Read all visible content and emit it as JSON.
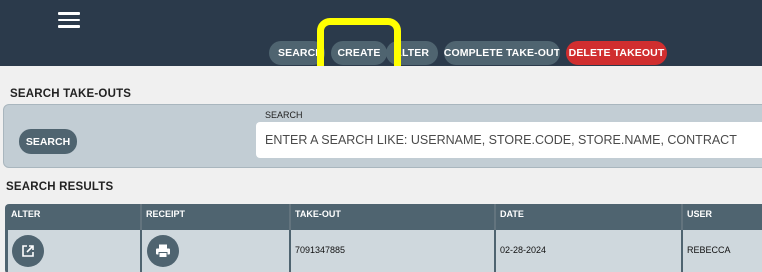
{
  "header": {
    "menu_icon": "hamburger-menu-icon",
    "actions": {
      "search": "SEARCH",
      "create": "CREATE",
      "alter": "ALTER",
      "complete": "COMPLETE TAKE-OUT",
      "delete": "DELETE TAKEOUT"
    },
    "highlight_color": "#ffff00"
  },
  "search_section": {
    "title": "SEARCH TAKE-OUTS",
    "button_label": "SEARCH",
    "field_label": "SEARCH",
    "placeholder": "ENTER A SEARCH LIKE: USERNAME, STORE.CODE, STORE.NAME, CONTRACT"
  },
  "results": {
    "title": "SEARCH RESULTS",
    "columns": [
      "ALTER",
      "RECEIPT",
      "TAKE-OUT",
      "DATE",
      "USER"
    ],
    "rows": [
      {
        "alter_icon": "open-in-new-icon",
        "receipt_icon": "print-icon",
        "take_out": "7091347885",
        "date": "02-28-2024",
        "user": "REBECCA"
      }
    ]
  },
  "colors": {
    "header_bg": "#2b3a4b",
    "button_bg": "#4f6470",
    "danger": "#d02e2f",
    "panel_bg": "#c2cdd4",
    "row_bg": "#cfd8dd"
  }
}
